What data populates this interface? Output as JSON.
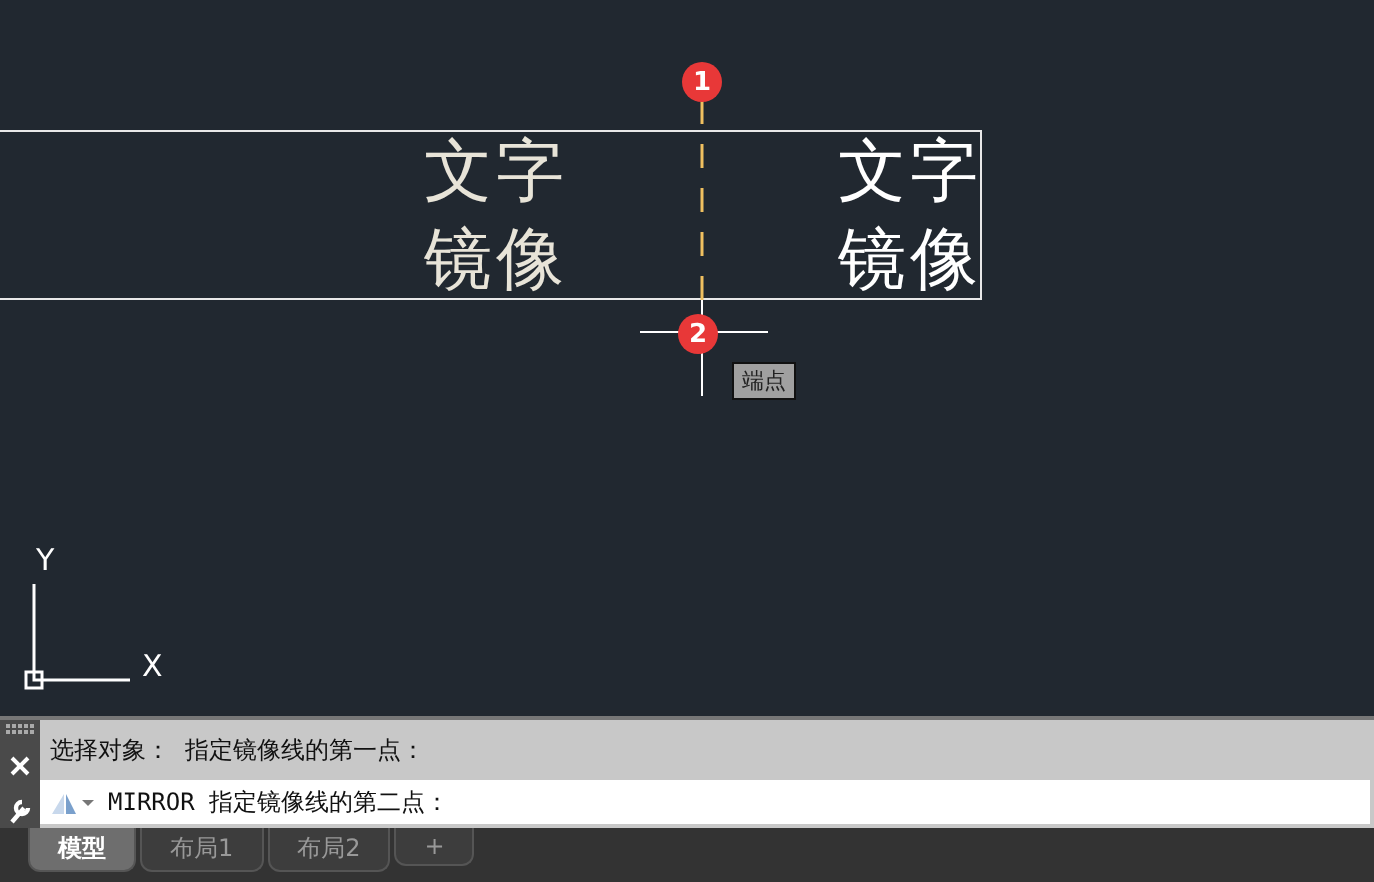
{
  "canvas": {
    "texts": [
      {
        "lines": [
          "文字",
          "镜像"
        ]
      },
      {
        "lines": [
          "文字",
          "镜像"
        ]
      }
    ],
    "markers": [
      "1",
      "2"
    ],
    "tooltip": "端点",
    "ucs": {
      "x_label": "X",
      "y_label": "Y"
    }
  },
  "command": {
    "history": "选择对象：  指定镜像线的第一点：",
    "prompt": "MIRROR 指定镜像线的第二点："
  },
  "tabs": [
    {
      "label": "模型",
      "selected": true
    },
    {
      "label": "布局1",
      "selected": false
    },
    {
      "label": "布局2",
      "selected": false
    },
    {
      "label": "+",
      "selected": false
    }
  ]
}
